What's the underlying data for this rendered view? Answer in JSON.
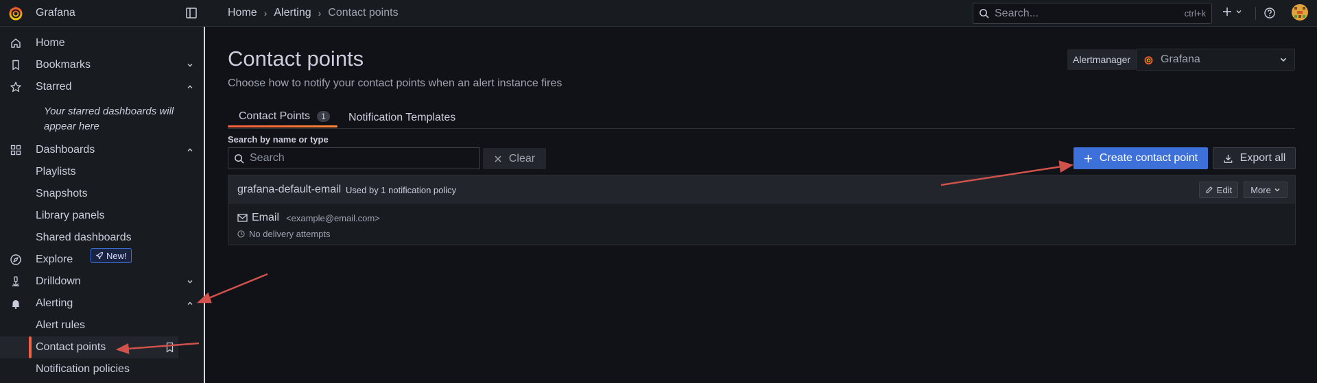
{
  "app": {
    "title": "Grafana"
  },
  "breadcrumb": [
    "Home",
    "Alerting",
    "Contact points"
  ],
  "search": {
    "placeholder": "Search...",
    "shortcut": "ctrl+k"
  },
  "sidebar": {
    "items": [
      {
        "label": "Home"
      },
      {
        "label": "Bookmarks"
      },
      {
        "label": "Starred"
      },
      {
        "label": "Dashboards"
      },
      {
        "label": "Explore"
      },
      {
        "label": "Drilldown"
      },
      {
        "label": "Alerting"
      }
    ],
    "starred_empty": "Your starred dashboards will appear here",
    "dashboards_children": [
      "Playlists",
      "Snapshots",
      "Library panels",
      "Shared dashboards"
    ],
    "new_badge": "New!",
    "alerting_children": [
      "Alert rules",
      "Contact points",
      "Notification policies"
    ]
  },
  "page": {
    "title": "Contact points",
    "description": "Choose how to notify your contact points when an alert instance fires",
    "alertmanager_label": "Alertmanager",
    "alertmanager_value": "Grafana"
  },
  "tabs": [
    {
      "label": "Contact Points",
      "count": "1"
    },
    {
      "label": "Notification Templates"
    }
  ],
  "filter": {
    "label": "Search by name or type",
    "placeholder": "Search",
    "clear_label": "Clear"
  },
  "actions": {
    "create_label": "Create contact point",
    "export_label": "Export all"
  },
  "contact_point": {
    "name": "grafana-default-email",
    "usage": "Used by 1 notification policy",
    "edit_label": "Edit",
    "more_label": "More",
    "integration": "Email",
    "address": "<example@email.com>",
    "status": "No delivery attempts"
  },
  "colors": {
    "accent": "#3d71d9",
    "active_tab": "#f55f3e",
    "annotation_arrow": "#d0524b"
  }
}
